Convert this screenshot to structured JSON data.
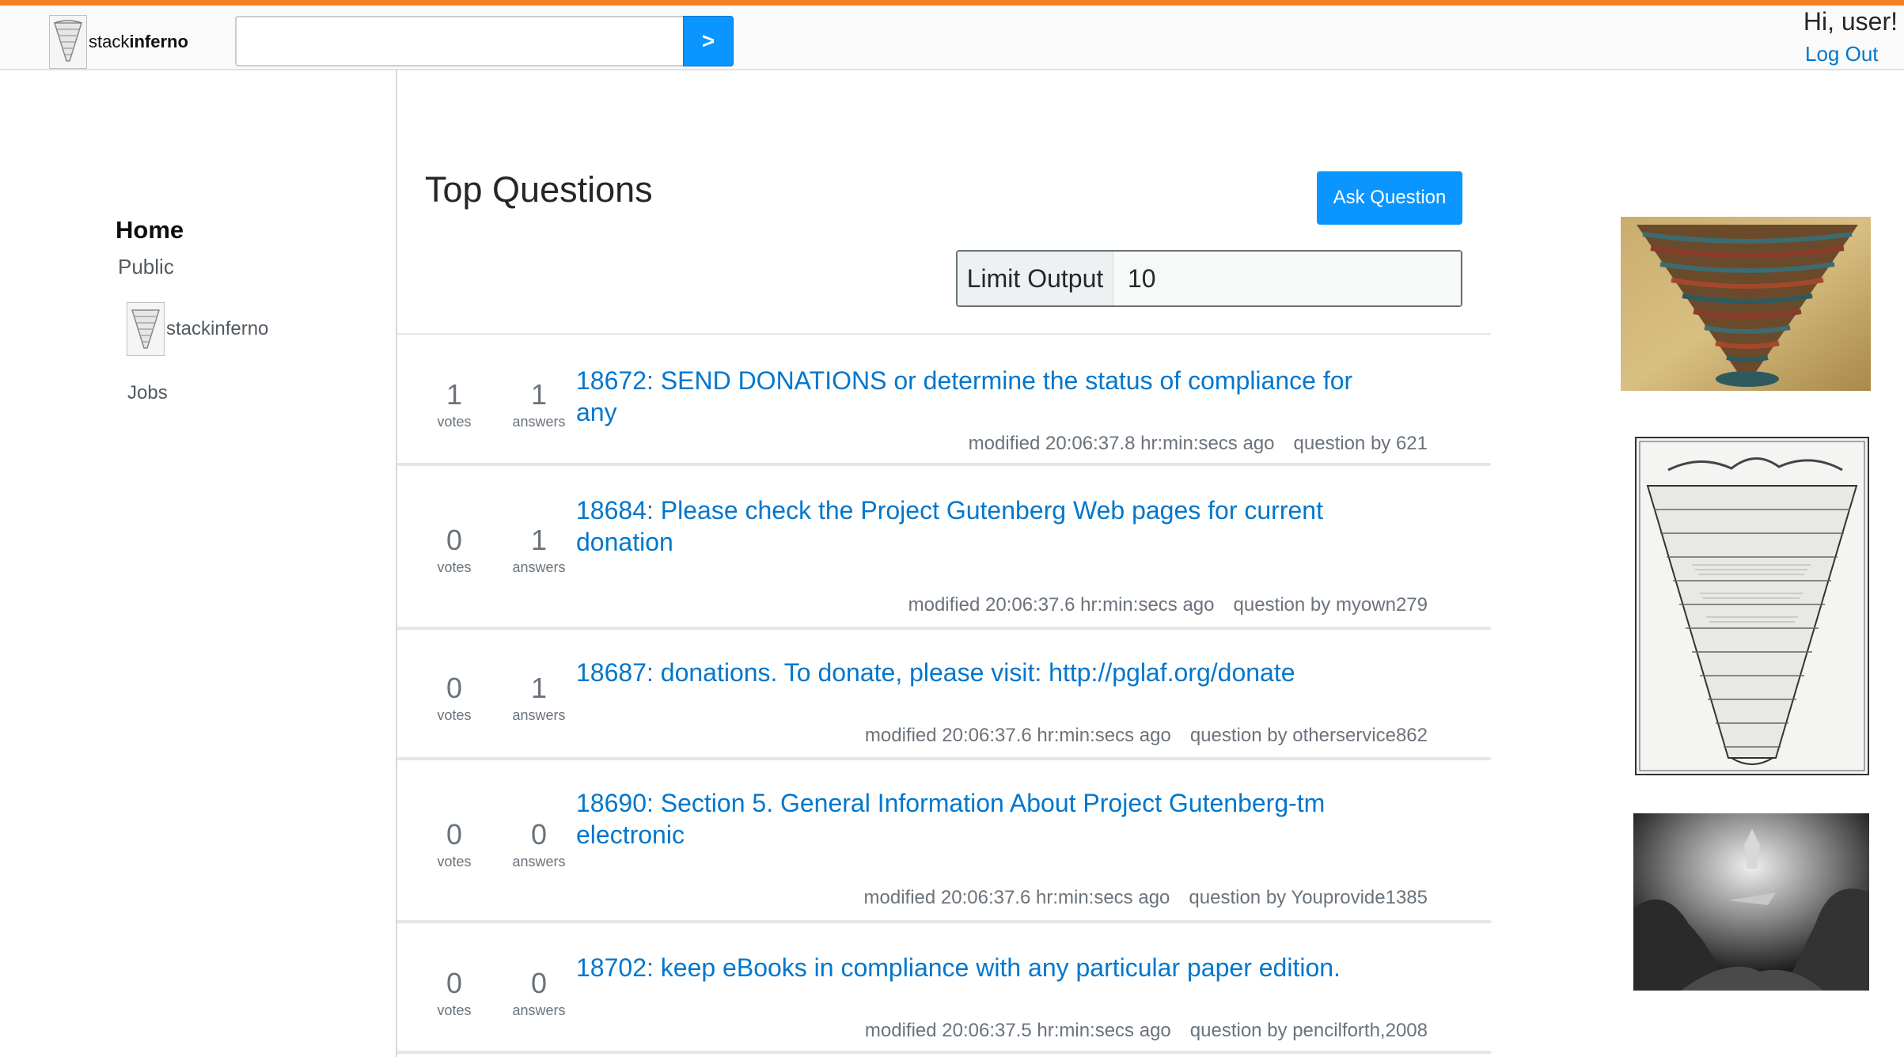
{
  "header": {
    "logo_prefix": "stack",
    "logo_suffix": "inferno",
    "search_placeholder": "",
    "search_button": ">",
    "greeting": "Hi, user!",
    "logout": "Log Out"
  },
  "sidebar": {
    "home": "Home",
    "public": "Public",
    "tag": "stackinferno",
    "jobs": "Jobs"
  },
  "main": {
    "title": "Top Questions",
    "ask_button": "Ask Question",
    "limit_label": "Limit Output",
    "limit_value": "10",
    "questions": [
      {
        "votes": "1",
        "votes_label": "votes",
        "answers": "1",
        "answers_label": "answers",
        "title": "18672: SEND DONATIONS or determine the status of compliance for any",
        "modified": "modified 20:06:37.8 hr:min:secs ago",
        "author": "question by 621"
      },
      {
        "votes": "0",
        "votes_label": "votes",
        "answers": "1",
        "answers_label": "answers",
        "title": "18684: Please check the Project Gutenberg Web pages for current donation",
        "modified": "modified 20:06:37.6 hr:min:secs ago",
        "author": "question by myown279"
      },
      {
        "votes": "0",
        "votes_label": "votes",
        "answers": "1",
        "answers_label": "answers",
        "title": "18687: donations. To donate, please visit: http://pglaf.org/donate",
        "modified": "modified 20:06:37.6 hr:min:secs ago",
        "author": "question by otherservice862"
      },
      {
        "votes": "0",
        "votes_label": "votes",
        "answers": "0",
        "answers_label": "answers",
        "title": "18690: Section 5. General Information About Project Gutenberg-tm electronic",
        "modified": "modified 20:06:37.6 hr:min:secs ago",
        "author": "question by Youprovide1385"
      },
      {
        "votes": "0",
        "votes_label": "votes",
        "answers": "0",
        "answers_label": "answers",
        "title": "18702: keep eBooks in compliance with any particular paper edition.",
        "modified": "modified 20:06:37.5 hr:min:secs ago",
        "author": "question by pencilforth,2008"
      }
    ]
  },
  "colors": {
    "accent_orange": "#f48024",
    "link_blue": "#0077cc",
    "button_blue": "#0a95ff"
  }
}
